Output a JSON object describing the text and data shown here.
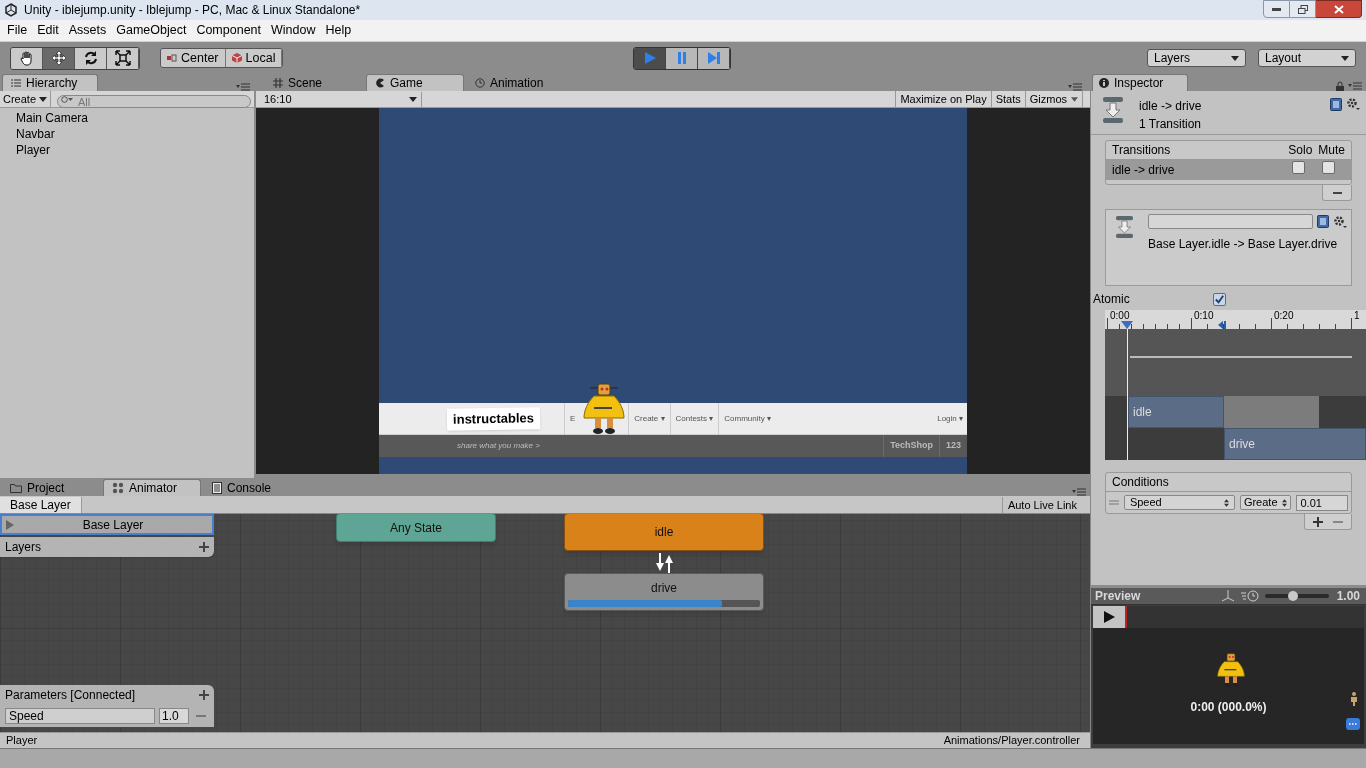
{
  "window": {
    "title": "Unity - iblejump.unity - Iblejump - PC, Mac & Linux Standalone*"
  },
  "menu": [
    "File",
    "Edit",
    "Assets",
    "GameObject",
    "Component",
    "Window",
    "Help"
  ],
  "toolbar": {
    "tools": [
      {
        "kind": "hand",
        "selected": false
      },
      {
        "kind": "move",
        "selected": true
      },
      {
        "kind": "rotate",
        "selected": false
      },
      {
        "kind": "scale",
        "selected": false
      }
    ],
    "pivot": [
      {
        "kind": "pivot",
        "label": "Center"
      },
      {
        "kind": "space",
        "label": "Local"
      }
    ],
    "playback": [
      {
        "kind": "play",
        "on": true
      },
      {
        "kind": "pause",
        "on": false
      },
      {
        "kind": "step",
        "on": false
      }
    ],
    "layers": "Layers",
    "layout": "Layout"
  },
  "hierarchy": {
    "tab": "Hierarchy",
    "create": "Create",
    "search": {
      "placeholder": "All"
    },
    "items": [
      "Main Camera",
      "Navbar",
      "Player"
    ]
  },
  "view_tabs": [
    {
      "label": "Scene",
      "kind": "scene",
      "selected": false
    },
    {
      "label": "Game",
      "kind": "game",
      "selected": true
    },
    {
      "label": "Animation",
      "kind": "animation",
      "selected": false
    }
  ],
  "game": {
    "aspect": "16:10",
    "buttons": [
      "Maximize on Play",
      "Stats",
      "Gizmos"
    ],
    "site": {
      "logo": "instructables",
      "nav": [
        "E",
        "Create ▾",
        "Contests ▾",
        "Community ▾"
      ],
      "login": "Login ▾",
      "tagline": "share what you make >",
      "partners": [
        "TechShop",
        "123"
      ]
    }
  },
  "bottom_tabs": [
    {
      "label": "Project",
      "kind": "project",
      "selected": false
    },
    {
      "label": "Animator",
      "kind": "animator",
      "selected": true
    },
    {
      "label": "Console",
      "kind": "console",
      "selected": false
    }
  ],
  "animator": {
    "breadcrumb": "Base Layer",
    "auto_live_link": "Auto Live Link",
    "layers": {
      "title": "Layers",
      "items": [
        {
          "name": "Base Layer",
          "selected": true
        }
      ]
    },
    "parameters": {
      "title": "Parameters [Connected]",
      "items": [
        {
          "name": "Speed",
          "value": "1.0"
        }
      ]
    },
    "states": [
      {
        "name": "Any State",
        "kind": "any"
      },
      {
        "name": "idle",
        "kind": "default"
      },
      {
        "name": "drive",
        "kind": "state",
        "level": 0.8
      }
    ],
    "status": {
      "object": "Player",
      "controller": "Animations/Player.controller"
    }
  },
  "inspector": {
    "tab": "Inspector",
    "title": "idle -> drive",
    "subtitle": "1 Transition",
    "transitions": {
      "title": "Transitions",
      "columns": [
        "Solo",
        "Mute"
      ],
      "rows": [
        {
          "name": "idle -> drive",
          "selected": true,
          "solo": false,
          "mute": false
        }
      ]
    },
    "transition": {
      "path": "Base Layer.idle -> Base Layer.drive"
    },
    "atomic": {
      "label": "Atomic",
      "checked": true
    },
    "timeline": {
      "ticks": [
        "0:00",
        "0:10",
        "0:20",
        "1"
      ],
      "clips": [
        "idle",
        "drive"
      ]
    },
    "conditions": {
      "title": "Conditions",
      "rows": [
        {
          "parameter": "Speed",
          "mode": "Greate",
          "value": "0.01"
        }
      ]
    }
  },
  "preview": {
    "title": "Preview",
    "speed": {
      "level": 0.45,
      "reading": "1.00"
    },
    "time": "0:00 (000.0%)"
  }
}
